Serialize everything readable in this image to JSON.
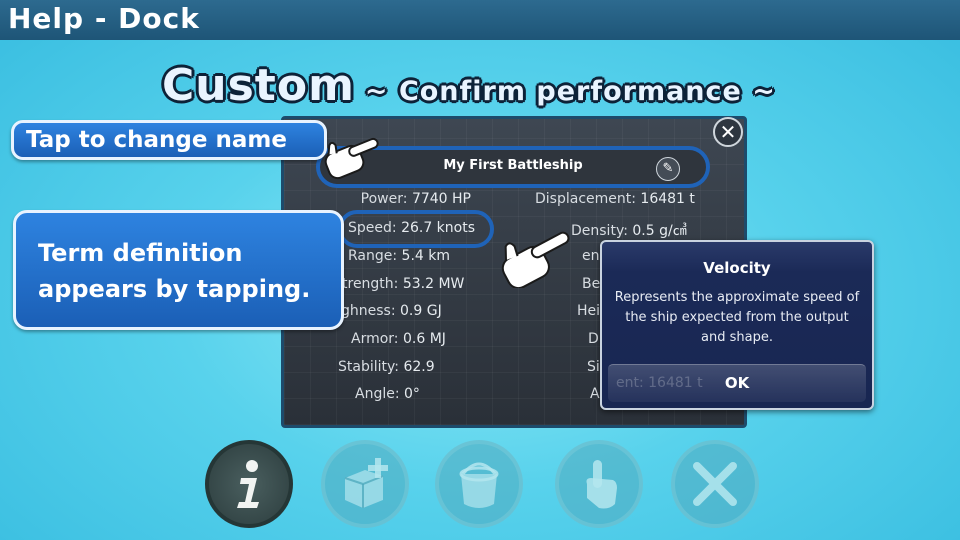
{
  "window": {
    "title": "Help - Dock"
  },
  "headline": {
    "main": "Custom",
    "sub": "~ Confirm performance ~"
  },
  "callouts": {
    "name": "Tap to change name",
    "term": "Term definition appears by tapping."
  },
  "ship": {
    "name": "My First Battleship",
    "stats_left": [
      {
        "label": "Power:",
        "value": "7740 HP"
      },
      {
        "label": "Speed:",
        "value": "26.7 knots"
      },
      {
        "label": "Range:",
        "value": "5.4 km"
      },
      {
        "label": "trength:",
        "value": "53.2 MW"
      },
      {
        "label": "ghness:",
        "value": "0.9 GJ"
      },
      {
        "label": "Armor:",
        "value": "0.6 MJ"
      },
      {
        "label": "Stability:",
        "value": "62.9"
      },
      {
        "label": "Angle:",
        "value": "0°"
      }
    ],
    "stats_right": [
      {
        "label": "Displacement:",
        "value": "16481 t"
      },
      {
        "label": "Density:",
        "value": "0.5 g/㎤"
      },
      {
        "label": "en",
        "value": ""
      },
      {
        "label": "Be",
        "value": ""
      },
      {
        "label": "Hei",
        "value": ""
      },
      {
        "label": "D",
        "value": ""
      },
      {
        "label": "Si",
        "value": ""
      },
      {
        "label": "A",
        "value": ""
      }
    ]
  },
  "popup": {
    "title": "Velocity",
    "body": "Represents the approximate speed of the ship expected from the output and shape.",
    "ok_label": "OK",
    "ghost_text": "ent: 16481 t"
  },
  "toolbar": {
    "icons": [
      "info-icon",
      "add-part-icon",
      "paint-bucket-icon",
      "tap-hand-icon",
      "close-icon"
    ]
  },
  "colors": {
    "accent": "#1f63b8",
    "background": "#58d2ec",
    "title_bar": "#1e5577"
  }
}
